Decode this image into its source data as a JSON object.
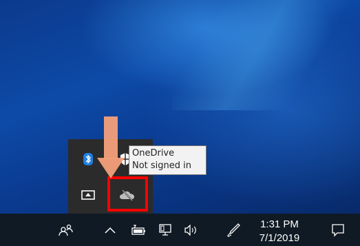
{
  "tooltip": {
    "title": "OneDrive",
    "status": "Not signed in"
  },
  "taskbar": {
    "time": "1:31 PM",
    "date": "7/1/2019",
    "icons": [
      "people-icon",
      "show-hidden-icons-chevron",
      "battery-icon",
      "network-icon",
      "volume-icon",
      "pen-workspace-icon",
      "action-center-icon"
    ]
  },
  "tray_flyout": {
    "icons": [
      "bluetooth-icon",
      "windows-defender-icon",
      "projection-icon",
      "onedrive-icon"
    ]
  },
  "annotations": {
    "arrow_color": "#f4a07a",
    "highlight_color": "#ff0000"
  }
}
